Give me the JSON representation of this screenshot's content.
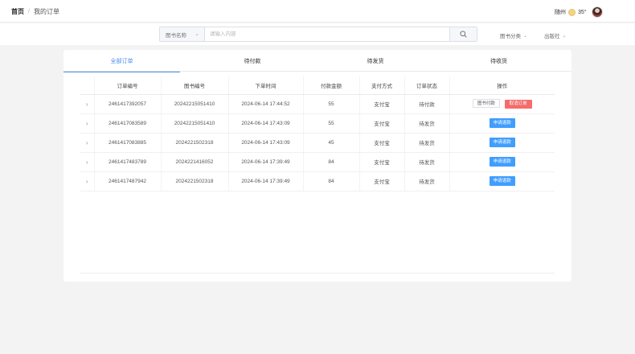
{
  "breadcrumb": {
    "home": "首页",
    "separator": "/",
    "current": "我的订单"
  },
  "weather": {
    "city": "随州",
    "temp": "35°"
  },
  "search": {
    "category_label": "图书名称",
    "placeholder": "请输入内容",
    "filters": [
      "图书分类",
      "出版社"
    ]
  },
  "tabs": [
    "全部订单",
    "待付款",
    "待发货",
    "待收货"
  ],
  "table": {
    "headers": [
      "",
      "订单编号",
      "图书编号",
      "下单时间",
      "付款金额",
      "支付方式",
      "订单状态",
      "操作"
    ],
    "rows": [
      {
        "order_no": "2461417392057",
        "book_no": "20242215051410",
        "time": "2024-06-14 17:44:52",
        "amount": "55",
        "pay": "支付宝",
        "status": "待付款"
      },
      {
        "order_no": "2461417083589",
        "book_no": "20242215051410",
        "time": "2024-06-14 17:43:09",
        "amount": "55",
        "pay": "支付宝",
        "status": "待发货"
      },
      {
        "order_no": "2461417083885",
        "book_no": "2024221502318",
        "time": "2024-06-14 17:43:09",
        "amount": "45",
        "pay": "支付宝",
        "status": "待发货"
      },
      {
        "order_no": "2461417483789",
        "book_no": "2024221416052",
        "time": "2024-06-14 17:39:49",
        "amount": "84",
        "pay": "支付宝",
        "status": "待发货"
      },
      {
        "order_no": "2461417487942",
        "book_no": "2024221502318",
        "time": "2024-06-14 17:39:49",
        "amount": "84",
        "pay": "支付宝",
        "status": "待发货"
      }
    ],
    "actions": {
      "pay": "图书付款",
      "cancel": "取消订单",
      "refund": "申请退款"
    },
    "expand_icon": "chevron-right-icon"
  },
  "colors": {
    "accent": "#4a8de8",
    "danger": "#f56c6c",
    "primary_btn": "#409eff"
  }
}
